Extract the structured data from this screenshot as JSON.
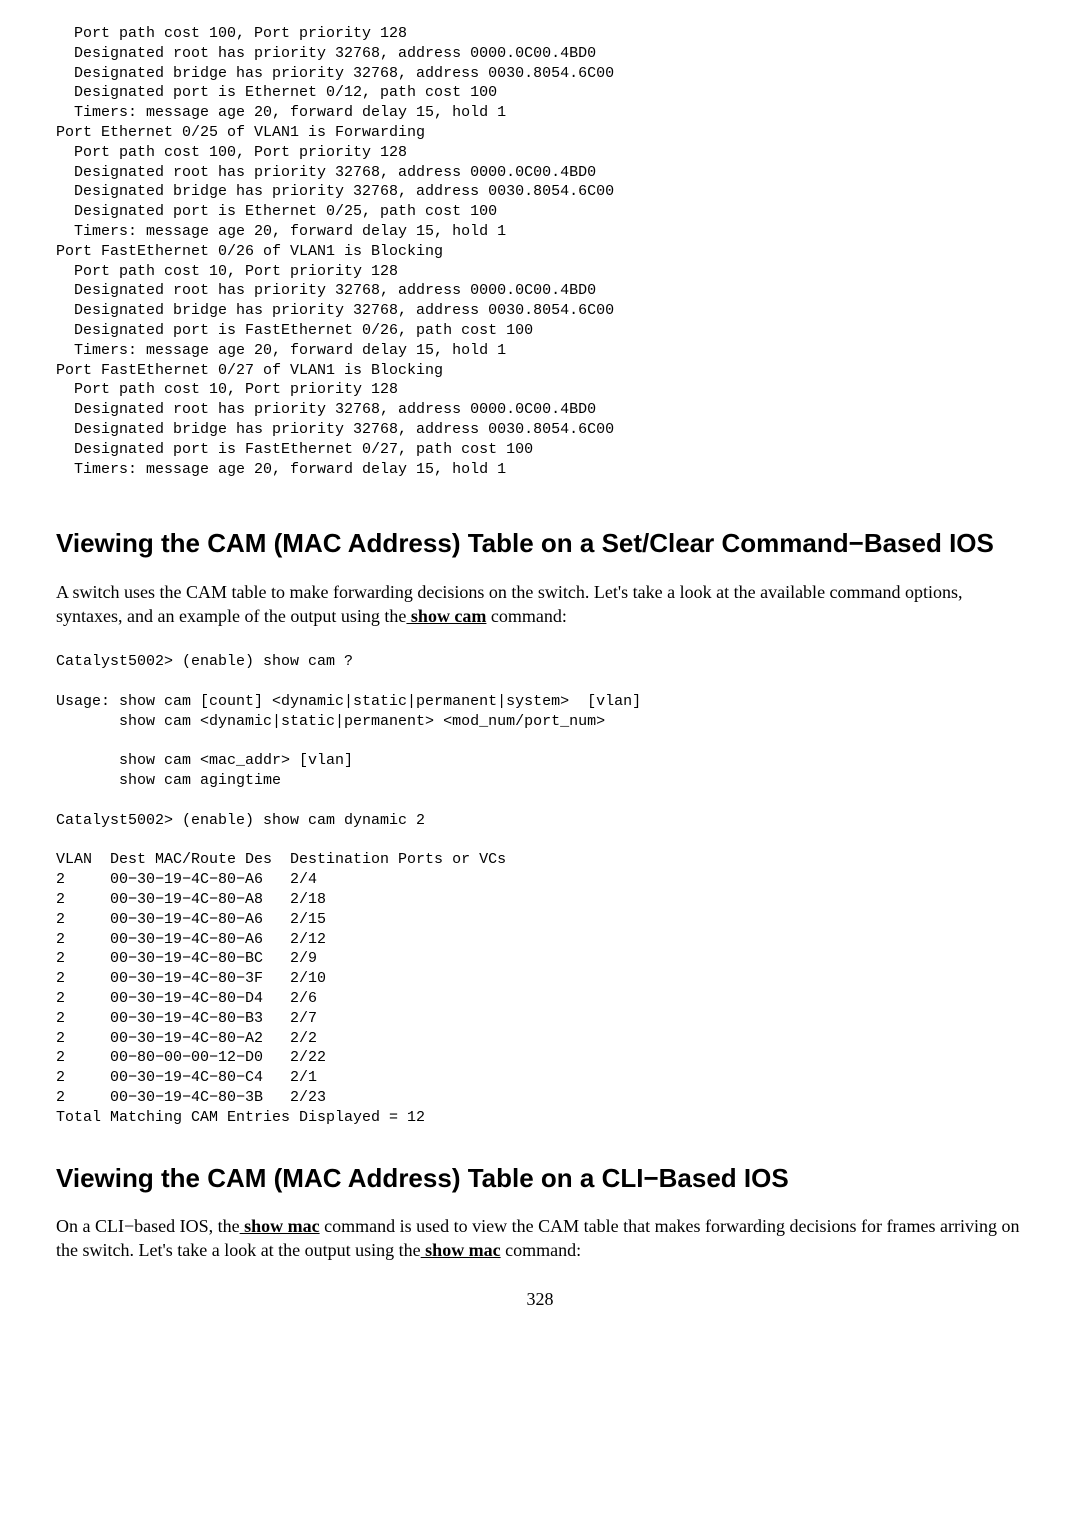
{
  "code_block_1": "  Port path cost 100, Port priority 128\n  Designated root has priority 32768, address 0000.0C00.4BD0\n  Designated bridge has priority 32768, address 0030.8054.6C00\n  Designated port is Ethernet 0/12, path cost 100\n  Timers: message age 20, forward delay 15, hold 1\nPort Ethernet 0/25 of VLAN1 is Forwarding\n  Port path cost 100, Port priority 128\n  Designated root has priority 32768, address 0000.0C00.4BD0\n  Designated bridge has priority 32768, address 0030.8054.6C00\n  Designated port is Ethernet 0/25, path cost 100\n  Timers: message age 20, forward delay 15, hold 1\nPort FastEthernet 0/26 of VLAN1 is Blocking\n  Port path cost 10, Port priority 128\n  Designated root has priority 32768, address 0000.0C00.4BD0\n  Designated bridge has priority 32768, address 0030.8054.6C00\n  Designated port is FastEthernet 0/26, path cost 100\n  Timers: message age 20, forward delay 15, hold 1\nPort FastEthernet 0/27 of VLAN1 is Blocking\n  Port path cost 10, Port priority 128\n  Designated root has priority 32768, address 0000.0C00.4BD0\n  Designated bridge has priority 32768, address 0030.8054.6C00\n  Designated port is FastEthernet 0/27, path cost 100\n  Timers: message age 20, forward delay 15, hold 1",
  "heading_1": "Viewing the CAM (MAC Address) Table on a Set/Clear Command−Based IOS",
  "para_1_a": "A switch uses the CAM table to make forwarding decisions on the switch. Let's take a look at the available command options, syntaxes, and an example of the output using the",
  "show_cam": " show cam",
  "para_1_b": " command:",
  "code_block_2": "Catalyst5002> (enable) show cam ?\n\nUsage: show cam [count] <dynamic|static|permanent|system>  [vlan]\n       show cam <dynamic|static|permanent> <mod_num/port_num>\n\n       show cam <mac_addr> [vlan]\n       show cam agingtime\n\nCatalyst5002> (enable) show cam dynamic 2\n\nVLAN  Dest MAC/Route Des  Destination Ports or VCs\n2     00−30−19−4C−80−A6   2/4\n2     00−30−19−4C−80−A8   2/18\n2     00−30−19−4C−80−A6   2/15\n2     00−30−19−4C−80−A6   2/12\n2     00−30−19−4C−80−BC   2/9\n2     00−30−19−4C−80−3F   2/10\n2     00−30−19−4C−80−D4   2/6\n2     00−30−19−4C−80−B3   2/7\n2     00−30−19−4C−80−A2   2/2\n2     00−80−00−00−12−D0   2/22\n2     00−30−19−4C−80−C4   2/1\n2     00−30−19−4C−80−3B   2/23\nTotal Matching CAM Entries Displayed = 12",
  "heading_2": "Viewing the CAM (MAC Address) Table on a CLI−Based IOS",
  "para_2_a": "On a CLI−based IOS, the",
  "show_mac_1": " show mac",
  "para_2_b": " command is used to view the CAM table that makes forwarding decisions for frames arriving on the switch. Let's take a look at the output using the",
  "show_mac_2": " show mac",
  "para_2_c": " command:",
  "page_number": "328"
}
